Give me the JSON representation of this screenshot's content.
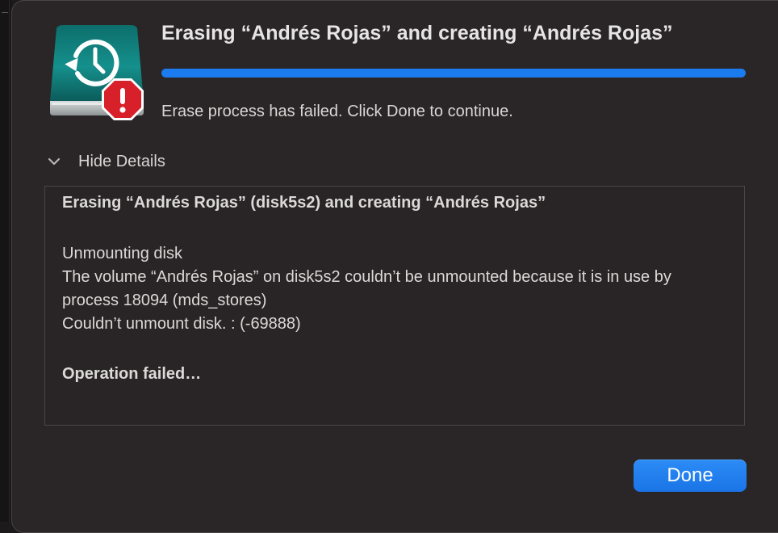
{
  "dialog": {
    "title": "Erasing “Andrés Rojas” and creating “Andrés Rojas”",
    "progress_fraction": 1.0,
    "status": "Erase process has failed. Click Done to continue.",
    "details_toggle_label": "Hide Details",
    "log": {
      "heading": "Erasing “Andrés Rojas” (disk5s2) and creating “Andrés Rojas”",
      "lines": [
        "Unmounting disk",
        "The volume “Andrés Rojas” on disk5s2 couldn’t be unmounted because it is in use by process 18094 (mds_stores)",
        "Couldn’t unmount disk. : (-69888)"
      ],
      "footer": "Operation failed…"
    },
    "done_label": "Done",
    "icons": {
      "drive": "time-machine-drive-icon",
      "badge": "error-badge-icon",
      "toggle": "chevron-down-icon"
    },
    "colors": {
      "accent": "#1b7cf0",
      "error": "#d8202a",
      "drive": "#0f7a78"
    }
  }
}
